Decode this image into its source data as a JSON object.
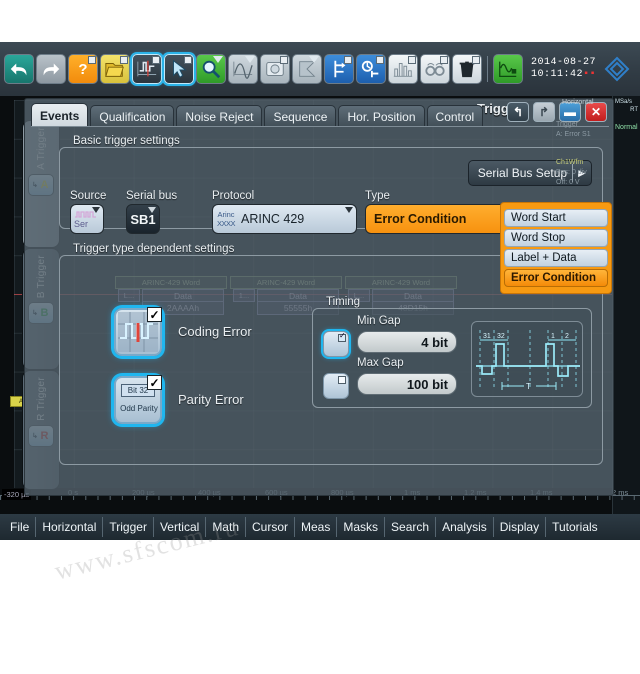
{
  "toolbar": {
    "buttons": [
      {
        "name": "undo-icon",
        "style": "tb-green",
        "glyph": "↰"
      },
      {
        "name": "redo-icon",
        "style": "tb-grey",
        "glyph": "↱"
      },
      {
        "name": "help-icon",
        "style": "tb-orange",
        "glyph": "?"
      },
      {
        "name": "open-folder-icon",
        "style": "tb-yellow",
        "glyph": "🗁"
      },
      {
        "name": "autoset-icon",
        "style": "tb-dark",
        "glyph": "⌁"
      },
      {
        "name": "pointer-icon",
        "style": "tb-dark",
        "glyph": "➤"
      },
      {
        "name": "zoom-icon",
        "style": "tb-lgreen",
        "glyph": "🔍"
      },
      {
        "name": "waveform-icon",
        "style": "tb-pale",
        "glyph": "∿"
      },
      {
        "name": "screenshot-icon",
        "style": "tb-pale",
        "glyph": "◎"
      },
      {
        "name": "flag-icon",
        "style": "tb-pale",
        "glyph": "⚑"
      },
      {
        "name": "reference-icon",
        "style": "tb-blue",
        "glyph": "⇥"
      },
      {
        "name": "timer-icon",
        "style": "tb-blue",
        "glyph": "⏱"
      },
      {
        "name": "histogram-icon",
        "style": "tb-white",
        "glyph": "▥"
      },
      {
        "name": "search-icon",
        "style": "tb-white",
        "glyph": "👓"
      },
      {
        "name": "delete-icon",
        "style": "tb-white",
        "glyph": "🗑"
      },
      {
        "name": "measure-icon",
        "style": "tb-lgreen",
        "glyph": "∿"
      }
    ],
    "selected_indices": [
      4,
      5
    ],
    "clock_date": "2014-08-27",
    "clock_time": "10:11:42",
    "clock_suffix": "▪▪"
  },
  "dialog": {
    "title": "Trigger",
    "window_buttons": [
      {
        "name": "back-button",
        "glyph": "↰",
        "style": "back"
      },
      {
        "name": "forward-button",
        "glyph": "↱",
        "style": "fwd"
      },
      {
        "name": "minimize-button",
        "glyph": "▬",
        "style": "min"
      },
      {
        "name": "close-button",
        "glyph": "✕",
        "style": "close"
      }
    ],
    "tabs": [
      {
        "label": "Events",
        "active": true
      },
      {
        "label": "Qualification",
        "active": false
      },
      {
        "label": "Noise Reject",
        "active": false
      },
      {
        "label": "Sequence",
        "active": false
      },
      {
        "label": "Hor. Position",
        "active": false
      },
      {
        "label": "Control",
        "active": false
      }
    ],
    "vertical_tabs": [
      {
        "label": "A Trigger",
        "letter": "A",
        "color": "#e8e040",
        "active": true
      },
      {
        "label": "B Trigger",
        "letter": "B",
        "color": "#2faa52",
        "active": false
      },
      {
        "label": "R Trigger",
        "letter": "R",
        "color": "#d03a3a",
        "active": false
      }
    ]
  },
  "basic": {
    "section_label": "Basic trigger settings",
    "serial_bus_setup_label": "Serial Bus Setup",
    "serial_bus_setup_chevron": "▶",
    "source_label": "Source",
    "source_value": "Ser",
    "serial_bus_label": "Serial bus",
    "serial_bus_value": "SB1",
    "protocol_label": "Protocol",
    "protocol_value": "ARINC 429",
    "protocol_icon_top": "Arinc",
    "protocol_icon_bottom": "XXXX",
    "type_label": "Type",
    "type_value": "Error Condition"
  },
  "type_dropdown": {
    "options": [
      {
        "label": "Word Start",
        "selected": false
      },
      {
        "label": "Word Stop",
        "selected": false
      },
      {
        "label": "Label + Data",
        "selected": false
      },
      {
        "label": "Error Condition",
        "selected": true
      }
    ]
  },
  "dependent": {
    "section_label": "Trigger type dependent settings",
    "coding_error_label": "Coding Error",
    "coding_error_checked": true,
    "parity_error_label": "Parity Error",
    "parity_error_checked": true,
    "parity_icon_top": "Bit 32",
    "parity_icon_bottom": "Odd Parity",
    "check_glyph": "✓"
  },
  "timing": {
    "section_label": "Timing",
    "min_gap_label": "Min Gap",
    "min_gap_value": "4 bit",
    "min_gap_enabled": true,
    "max_gap_label": "Max Gap",
    "max_gap_value": "100 bit",
    "max_gap_enabled": false,
    "waveform_bit_labels": [
      "31",
      "32",
      "1",
      "2"
    ],
    "waveform_period_label": "T"
  },
  "decode": {
    "words": [
      {
        "outer": "ARINC-429 Word",
        "label": "L...",
        "data_label": "Data",
        "data": "2AAAAh"
      },
      {
        "outer": "ARINC-429 Word",
        "label": "1...",
        "data_label": "Data",
        "data": "55555h"
      },
      {
        "outer": "ARINC-429 Word",
        "label": "L...",
        "data_label": "Data",
        "data": "48D15h"
      }
    ]
  },
  "right_panel": {
    "sample_rate": "MSa/s",
    "rt": "RT",
    "mode": "Normal",
    "trigger_header": "Trigger",
    "trigger_value": "A:  Error  S1",
    "wfm_header": "Ch1Wfm",
    "wfm_pos": "Pos: 0 div",
    "wfm_off": "Off: 0 V",
    "horizontal": "Horizontal"
  },
  "time_axis": {
    "start_label": "-320 µs",
    "ticks": [
      "0 s",
      "200 µs",
      "400 µs",
      "600 µs",
      "800 µs",
      "1 ms",
      "1.2 ms",
      "1.4 ms",
      "2 ms"
    ]
  },
  "bottom_menu": {
    "items": [
      "File",
      "Horizontal",
      "Trigger",
      "Vertical",
      "Math",
      "Cursor",
      "Meas",
      "Masks",
      "Search",
      "Analysis",
      "Display",
      "Tutorials"
    ]
  },
  "trigger_marker": {
    "label": "A"
  },
  "watermark": {
    "text": "www.sfscom.ru"
  },
  "colors": {
    "accent_orange": "#f7920f",
    "accent_cyan": "#1fb6ef",
    "panel_bg": "#54626c",
    "scope_bg": "#131a1e"
  }
}
